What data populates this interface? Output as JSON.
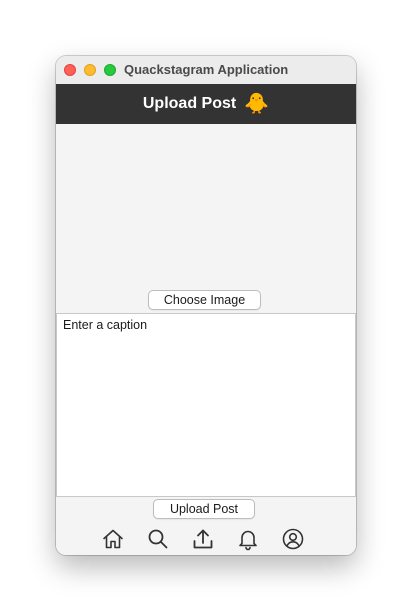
{
  "window": {
    "title": "Quackstagram Application"
  },
  "header": {
    "title": "Upload Post",
    "logo_emoji": "🐥"
  },
  "image_area": {
    "choose_button_label": "Choose Image"
  },
  "caption": {
    "value": "Enter a caption"
  },
  "upload_button_label": "Upload Post",
  "navbar": {
    "items": [
      {
        "icon": "home-icon"
      },
      {
        "icon": "search-icon"
      },
      {
        "icon": "upload-icon"
      },
      {
        "icon": "bell-icon"
      },
      {
        "icon": "profile-icon"
      }
    ]
  },
  "colors": {
    "header_bg": "#333333",
    "header_text": "#ffffff",
    "content_bg": "#f4f4f4",
    "close": "#ff5f57",
    "minimize": "#febc2e",
    "zoom": "#28c840"
  }
}
